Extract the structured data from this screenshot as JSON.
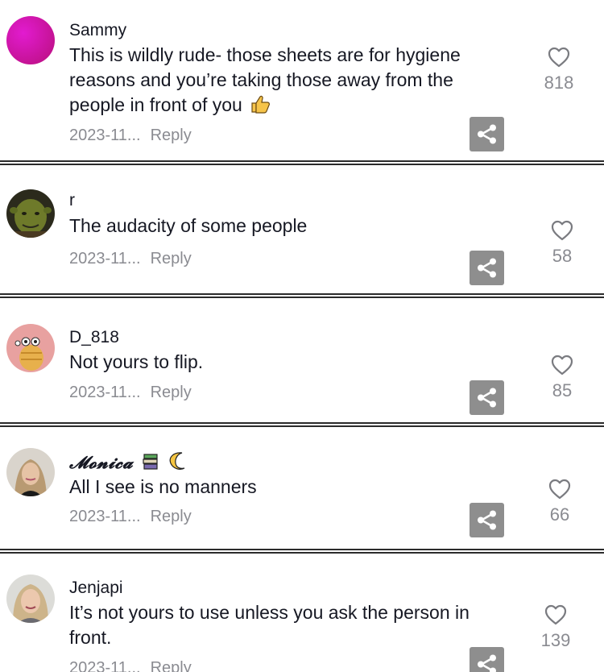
{
  "comments": [
    {
      "username": "Sammy",
      "text": "This is wildly rude- those sheets are for hygiene reasons and you’re taking those away from the people in front of you",
      "emoji": "thumbs-up",
      "date": "2023-11...",
      "reply": "Reply",
      "likes": "818",
      "avatar": "magenta-gradient-avatar"
    },
    {
      "username": "r",
      "text": "The audacity of some people",
      "date": "2023-11...",
      "reply": "Reply",
      "likes": "58",
      "avatar": "green-ogre-avatar"
    },
    {
      "username": "D_818",
      "text": "Not yours to flip.",
      "date": "2023-11...",
      "reply": "Reply",
      "likes": "85",
      "avatar": "cartoon-character-avatar"
    },
    {
      "username": "𝓜𝓸𝓷𝓲𝓬𝓪",
      "username_emojis": [
        "books",
        "crescent-moon"
      ],
      "text": "All I see is no manners",
      "date": "2023-11...",
      "reply": "Reply",
      "likes": "66",
      "avatar": "woman-photo-avatar"
    },
    {
      "username": "Jenjapi",
      "text": "It’s not yours to use unless you ask the person in front.",
      "date": "2023-11...",
      "reply": "Reply",
      "likes": "139",
      "avatar": "woman-photo-avatar"
    }
  ],
  "colors": {
    "text": "#161823",
    "secondary": "#8a8b91",
    "share_bg": "#8e8e8e"
  }
}
